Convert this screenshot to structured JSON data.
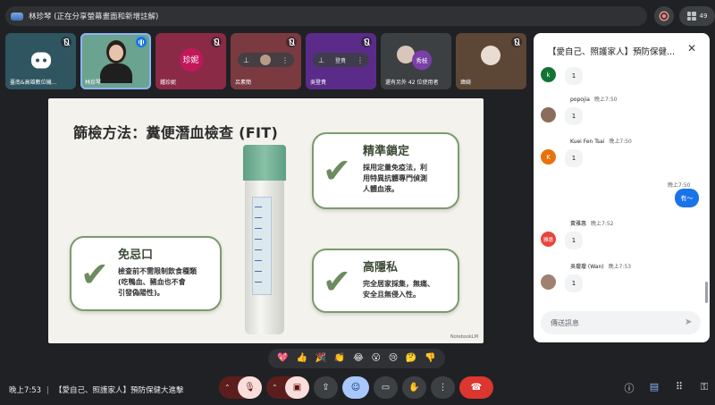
{
  "banner": {
    "text": "林珍琴 (正在分享螢幕畫面和新增註解)"
  },
  "top_right": {
    "participant_count": "49"
  },
  "tiles": [
    {
      "name": "臺南&高雄數位機...",
      "avatar_text": "",
      "color": "#2f5560"
    },
    {
      "name": "林珍琴",
      "avatar_text": "",
      "color": "#6aa38f"
    },
    {
      "name": "鍾珍妮",
      "avatar_text": "珍妮",
      "color": "#8b2a47"
    },
    {
      "name": "呂素簡",
      "avatar_text": "",
      "color": "#7a3a40"
    },
    {
      "name": "吳登貴",
      "avatar_text": "",
      "color": "#5b2b8a"
    },
    {
      "name": "還有另外 42 位使用者",
      "avatar_text": "秀枝",
      "color": "#3c4043"
    },
    {
      "name": "瑋綺",
      "avatar_text": "",
      "color": "#5c4636"
    }
  ],
  "slide": {
    "title": "篩檢方法：糞便潛血檢查 (FIT)",
    "cards": [
      {
        "heading": "精準鎖定",
        "body": [
          "採用定量免疫法，利",
          "用特異抗體專門偵測",
          "人體血液。"
        ]
      },
      {
        "heading": "免忌口",
        "body": [
          "檢查前不需限制飲食種類",
          "(吃鴨血、豬血也不會",
          "引發偽陽性)。"
        ]
      },
      {
        "heading": "高隱私",
        "body": [
          "完全居家採集，無痛、",
          "安全且無侵入性。"
        ]
      }
    ],
    "watermark": "NotebookLM"
  },
  "reactions": [
    "💖",
    "👍",
    "🎉",
    "👏",
    "😂",
    "😮",
    "😢",
    "🤔",
    "👎"
  ],
  "bottom": {
    "time": "晚上7:53",
    "meeting_title": "【愛自己、照護家人】預防保健大進擊"
  },
  "chat": {
    "title": "【愛自己、照護家人】預防保健...",
    "messages": [
      {
        "sender": "",
        "time": "",
        "text": "1",
        "initial": "k",
        "color": "#137333"
      },
      {
        "sender": "popojia",
        "time": "晚上7:50",
        "text": "1",
        "initial": "",
        "color": "#8a6d5a"
      },
      {
        "sender": "Kuei Fen Tsai",
        "time": "晚上7:50",
        "text": "1",
        "initial": "K",
        "color": "#e8710a"
      },
      {
        "sender": "黃雅惠",
        "time": "晚上7:52",
        "text": "1",
        "initial": "雅惠",
        "color": "#e8453c"
      },
      {
        "sender": "吳瓊瓊 (Wan)",
        "time": "晚上7:53",
        "text": "1",
        "initial": "",
        "color": "#a08070"
      }
    ],
    "self": {
      "time": "晚上7:50",
      "text": "有～"
    },
    "input_placeholder": "傳送訊息"
  }
}
